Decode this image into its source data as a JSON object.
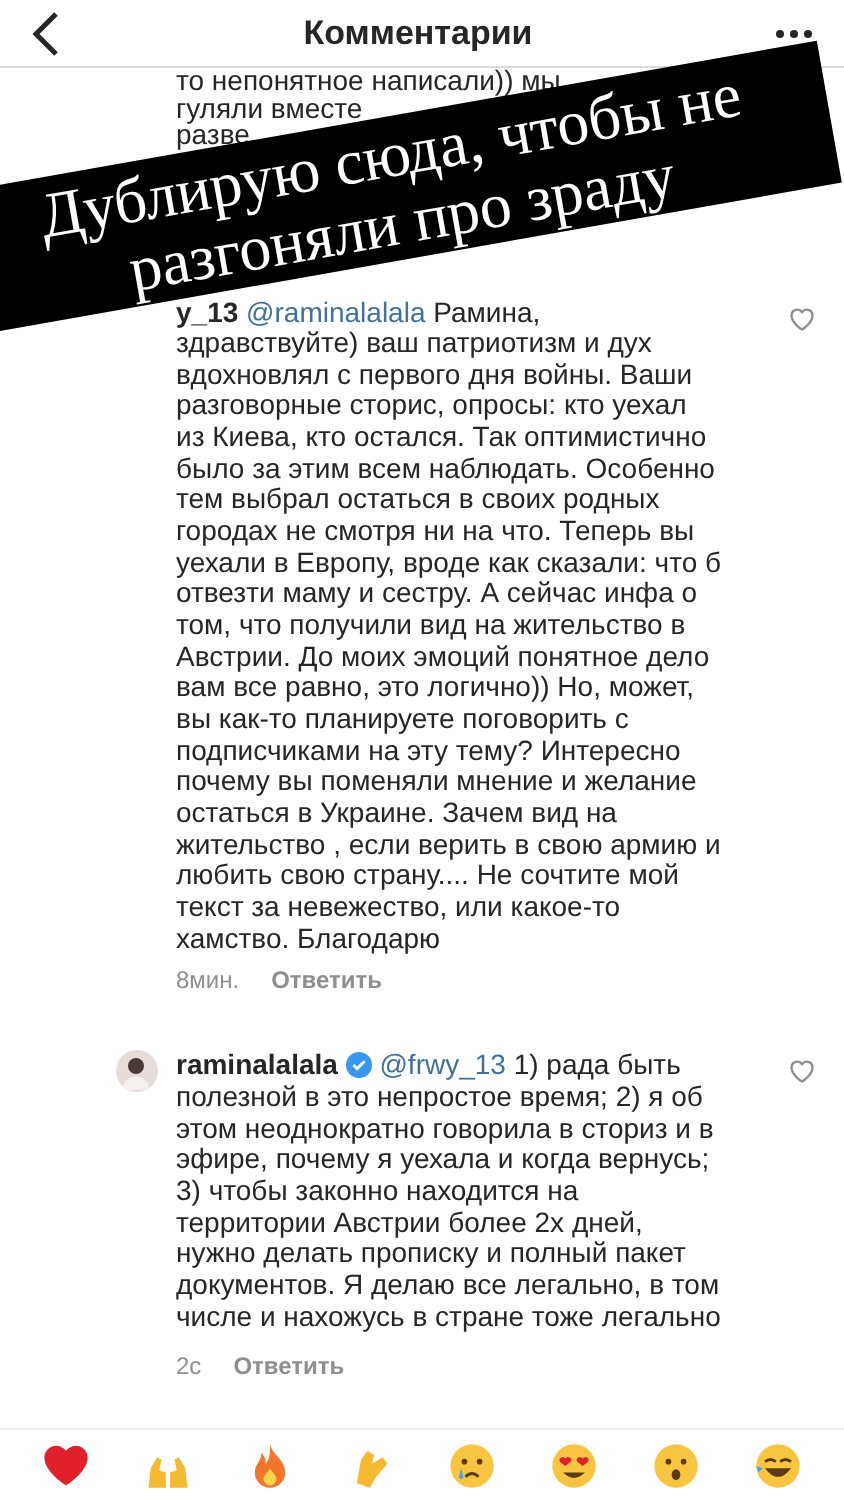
{
  "header": {
    "title": "Комментарии"
  },
  "comments": [
    {
      "kind": "cut",
      "lines": [
        "то непонятное написали)) мы",
        "гуляли вместе",
        "разве"
      ]
    },
    {
      "kind": "full",
      "username": "y_13",
      "mention": "@raminalalala",
      "text": "Рамина,\nздравствуйте) ваш патриотизм и  дух\nвдохновлял с первого дня войны. Ваши\nразговорные сторис, опросы: кто уехал\nиз Киева, кто остался. Так оптимистично\nбыло за этим всем наблюдать. Особенно\nтем выбрал остаться в своих родных\nгородах не смотря ни на что. Теперь вы\nуехали в Европу, вроде как сказали: что б\nотвезти маму и сестру. А сейчас инфа о\nтом, что получили вид на жительство в\nАвстрии. До моих эмоций понятное дело\nвам все равно, это логично)) Но, может,\nвы как-то планируете поговорить с\nподписчиками на эту тему? Интересно\nпочему вы поменяли мнение и желание\nостаться в Украине. Зачем вид на\nжительство , если верить в свою армию и\nлюбить свою страну.... Не сочтите мой\nтекст за невежество, или какое-то\nхамство. Благодарю",
      "time": "8мин.",
      "reply": "Ответить"
    },
    {
      "kind": "full",
      "avatar": true,
      "username": "raminalalala",
      "verified": true,
      "mention": "@frwy_13",
      "text": "1) рада быть\nполезной в это непростое время; 2) я об\nэтом неоднократно говорила в сториз и в\nэфире, почему я уехала и когда вернусь;\n3) чтобы законно находится на\nтерритории Австрии более 2х дней,\nнужно делать прописку и полный пакет\nдокументов. Я делаю все легально, в том\nчисле и нахожусь в стране тоже легально",
      "time": "2с",
      "reply": "Ответить"
    }
  ],
  "banner": {
    "lines": [
      "Дублирую сюда, чтобы не",
      "разгоняли про зраду"
    ]
  },
  "reactions": [
    {
      "kind": "heart"
    },
    {
      "kind": "raised-hands"
    },
    {
      "kind": "fire"
    },
    {
      "kind": "clap"
    },
    {
      "kind": "cry"
    },
    {
      "kind": "heart-eyes"
    },
    {
      "kind": "surprised"
    },
    {
      "kind": "laugh"
    }
  ]
}
